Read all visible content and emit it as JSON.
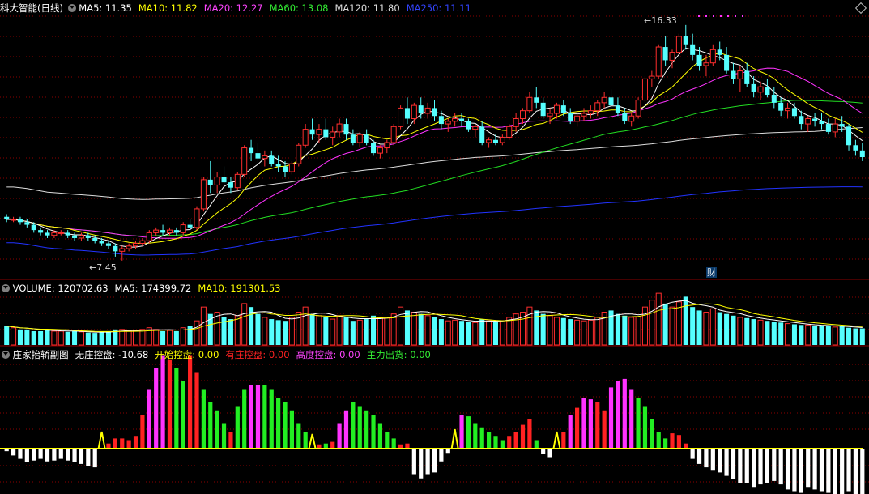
{
  "main_panel": {
    "title": "科大智能(日线)",
    "ma_labels": [
      {
        "text": "MA5: 11.35",
        "color": "#ffffff"
      },
      {
        "text": "MA10: 11.82",
        "color": "#ffff00"
      },
      {
        "text": "MA20: 12.27",
        "color": "#ff44ff"
      },
      {
        "text": "MA60: 13.08",
        "color": "#33ee33"
      },
      {
        "text": "MA120: 11.80",
        "color": "#dddddd"
      },
      {
        "text": "MA250: 11.11",
        "color": "#3344ff"
      }
    ],
    "high_label": "16.33",
    "low_label": "7.45",
    "event_marker": "财",
    "settings_icon": "diamond-icon"
  },
  "volume_panel": {
    "labels": [
      {
        "text": "VOLUME: 120702.63",
        "color": "#ffffff"
      },
      {
        "text": "MA5: 174399.72",
        "color": "#ffffff"
      },
      {
        "text": "MA10: 191301.53",
        "color": "#ffff00"
      }
    ]
  },
  "indicator_panel": {
    "labels": [
      {
        "text": "庄家抬轿副图",
        "color": "#ffffff"
      },
      {
        "text": "无庄控盘: -10.68",
        "color": "#ffffff"
      },
      {
        "text": "开始控盘: 0.00",
        "color": "#ffff00"
      },
      {
        "text": "有庄控盘: 0.00",
        "color": "#ff2222"
      },
      {
        "text": "高度控盘: 0.00",
        "color": "#ff44ff"
      },
      {
        "text": "主力出货: 0.00",
        "color": "#33ee33"
      }
    ]
  },
  "colors": {
    "up": "#ff2e2e",
    "down": "#55ffff",
    "grid": "#8b0000",
    "magenta": "#ff33ff",
    "green": "#22ee22",
    "red": "#ff2222",
    "yellow": "#ffff00",
    "white": "#ffffff"
  },
  "chart_data": {
    "type": "candlestick",
    "price_high": 16.33,
    "price_low": 7.45,
    "candles": [
      [
        9.1,
        9.2,
        8.9,
        9.0
      ],
      [
        9.0,
        9.1,
        8.9,
        9.0
      ],
      [
        9.0,
        9.1,
        8.8,
        8.9
      ],
      [
        8.9,
        9.0,
        8.7,
        8.8
      ],
      [
        8.8,
        8.9,
        8.5,
        8.6
      ],
      [
        8.6,
        8.7,
        8.4,
        8.5
      ],
      [
        8.5,
        8.6,
        8.3,
        8.4
      ],
      [
        8.4,
        8.6,
        8.3,
        8.5
      ],
      [
        8.5,
        8.6,
        8.4,
        8.5
      ],
      [
        8.5,
        8.6,
        8.3,
        8.4
      ],
      [
        8.4,
        8.5,
        8.2,
        8.3
      ],
      [
        8.3,
        8.5,
        8.2,
        8.4
      ],
      [
        8.4,
        8.5,
        8.2,
        8.3
      ],
      [
        8.3,
        8.4,
        8.1,
        8.2
      ],
      [
        8.2,
        8.3,
        8.0,
        8.1
      ],
      [
        8.1,
        8.2,
        7.9,
        8.0
      ],
      [
        8.0,
        8.1,
        7.6,
        7.8
      ],
      [
        7.8,
        8.0,
        7.45,
        7.9
      ],
      [
        7.9,
        8.1,
        7.8,
        8.0
      ],
      [
        8.0,
        8.2,
        7.9,
        8.1
      ],
      [
        8.1,
        8.3,
        8.0,
        8.2
      ],
      [
        8.2,
        8.6,
        8.1,
        8.5
      ],
      [
        8.5,
        8.7,
        8.4,
        8.6
      ],
      [
        8.6,
        8.8,
        8.4,
        8.5
      ],
      [
        8.5,
        8.7,
        8.4,
        8.6
      ],
      [
        8.6,
        8.7,
        8.4,
        8.5
      ],
      [
        8.5,
        8.9,
        8.4,
        8.8
      ],
      [
        8.8,
        9.0,
        8.6,
        8.7
      ],
      [
        8.7,
        9.5,
        8.6,
        9.4
      ],
      [
        9.4,
        10.6,
        9.3,
        10.5
      ],
      [
        10.5,
        11.2,
        10.0,
        10.3
      ],
      [
        10.3,
        10.8,
        10.0,
        10.6
      ],
      [
        10.6,
        11.0,
        10.2,
        10.4
      ],
      [
        10.4,
        10.6,
        10.0,
        10.2
      ],
      [
        10.2,
        10.8,
        10.1,
        10.7
      ],
      [
        10.7,
        11.8,
        10.6,
        11.7
      ],
      [
        11.7,
        12.0,
        11.2,
        11.5
      ],
      [
        11.5,
        11.9,
        11.1,
        11.3
      ],
      [
        11.3,
        11.6,
        11.0,
        11.4
      ],
      [
        11.4,
        11.6,
        11.0,
        11.1
      ],
      [
        11.1,
        11.4,
        10.8,
        11.0
      ],
      [
        11.0,
        11.2,
        10.6,
        10.8
      ],
      [
        10.8,
        11.2,
        10.7,
        11.1
      ],
      [
        11.1,
        11.9,
        11.0,
        11.8
      ],
      [
        11.8,
        12.6,
        11.7,
        12.4
      ],
      [
        12.4,
        12.8,
        12.0,
        12.2
      ],
      [
        12.2,
        12.6,
        11.9,
        12.4
      ],
      [
        12.4,
        12.8,
        12.0,
        12.1
      ],
      [
        12.1,
        12.5,
        11.8,
        12.3
      ],
      [
        12.3,
        12.8,
        12.1,
        12.6
      ],
      [
        12.6,
        12.8,
        12.0,
        12.2
      ],
      [
        12.2,
        12.4,
        11.8,
        11.9
      ],
      [
        11.9,
        12.3,
        11.7,
        12.2
      ],
      [
        12.2,
        12.4,
        11.8,
        11.9
      ],
      [
        11.9,
        12.0,
        11.4,
        11.5
      ],
      [
        11.5,
        11.8,
        11.3,
        11.7
      ],
      [
        11.7,
        12.0,
        11.5,
        11.9
      ],
      [
        11.9,
        12.6,
        11.8,
        12.5
      ],
      [
        12.5,
        13.3,
        12.4,
        13.2
      ],
      [
        13.2,
        13.6,
        12.6,
        12.8
      ],
      [
        12.8,
        13.4,
        12.6,
        13.3
      ],
      [
        13.3,
        13.6,
        12.8,
        13.0
      ],
      [
        13.0,
        13.4,
        12.8,
        13.2
      ],
      [
        13.2,
        13.5,
        12.7,
        12.9
      ],
      [
        12.9,
        13.1,
        12.4,
        12.6
      ],
      [
        12.6,
        12.8,
        12.3,
        12.7
      ],
      [
        12.7,
        13.0,
        12.5,
        12.8
      ],
      [
        12.8,
        13.0,
        12.5,
        12.7
      ],
      [
        12.7,
        12.8,
        12.3,
        12.4
      ],
      [
        12.4,
        12.6,
        12.1,
        12.5
      ],
      [
        12.5,
        12.7,
        11.8,
        11.9
      ],
      [
        11.9,
        12.1,
        11.7,
        12.0
      ],
      [
        12.0,
        12.2,
        11.8,
        11.9
      ],
      [
        11.9,
        12.2,
        11.8,
        12.1
      ],
      [
        12.1,
        12.6,
        12.0,
        12.5
      ],
      [
        12.5,
        13.0,
        12.3,
        12.8
      ],
      [
        12.8,
        13.2,
        12.6,
        13.1
      ],
      [
        13.1,
        13.8,
        13.0,
        13.6
      ],
      [
        13.6,
        14.0,
        13.2,
        13.4
      ],
      [
        13.4,
        13.6,
        12.8,
        12.9
      ],
      [
        12.9,
        13.2,
        12.6,
        13.0
      ],
      [
        13.0,
        13.4,
        12.8,
        13.3
      ],
      [
        13.3,
        13.5,
        12.9,
        13.0
      ],
      [
        13.0,
        13.2,
        12.6,
        12.7
      ],
      [
        12.7,
        13.0,
        12.5,
        12.9
      ],
      [
        12.9,
        13.2,
        12.7,
        13.0
      ],
      [
        13.0,
        13.3,
        12.8,
        13.1
      ],
      [
        13.1,
        13.5,
        12.9,
        13.4
      ],
      [
        13.4,
        13.8,
        13.2,
        13.6
      ],
      [
        13.6,
        13.9,
        13.2,
        13.3
      ],
      [
        13.3,
        13.6,
        12.9,
        13.0
      ],
      [
        13.0,
        13.2,
        12.6,
        12.7
      ],
      [
        12.7,
        13.0,
        12.5,
        12.9
      ],
      [
        12.9,
        13.6,
        12.8,
        13.5
      ],
      [
        13.5,
        14.4,
        13.4,
        14.3
      ],
      [
        14.3,
        14.6,
        14.0,
        14.4
      ],
      [
        14.4,
        15.6,
        14.3,
        15.5
      ],
      [
        15.5,
        15.9,
        14.8,
        15.0
      ],
      [
        15.0,
        15.4,
        14.7,
        15.3
      ],
      [
        15.3,
        16.0,
        15.2,
        15.9
      ],
      [
        15.9,
        16.33,
        15.4,
        15.6
      ],
      [
        15.6,
        16.0,
        15.0,
        15.2
      ],
      [
        15.2,
        15.5,
        14.6,
        14.8
      ],
      [
        14.8,
        15.2,
        14.4,
        14.9
      ],
      [
        14.9,
        15.6,
        14.8,
        15.4
      ],
      [
        15.4,
        15.7,
        15.0,
        15.2
      ],
      [
        15.2,
        15.5,
        14.5,
        14.6
      ],
      [
        14.6,
        14.9,
        14.1,
        14.3
      ],
      [
        14.3,
        14.8,
        13.8,
        14.6
      ],
      [
        14.6,
        14.9,
        14.0,
        14.1
      ],
      [
        14.1,
        14.4,
        13.6,
        13.8
      ],
      [
        13.8,
        14.2,
        13.5,
        14.0
      ],
      [
        14.0,
        14.3,
        13.6,
        13.7
      ],
      [
        13.7,
        14.0,
        13.2,
        13.4
      ],
      [
        13.4,
        13.6,
        12.9,
        13.1
      ],
      [
        13.1,
        13.4,
        12.8,
        13.2
      ],
      [
        13.2,
        13.4,
        12.8,
        12.9
      ],
      [
        12.9,
        13.1,
        12.4,
        12.6
      ],
      [
        12.6,
        12.9,
        12.3,
        12.8
      ],
      [
        12.8,
        13.0,
        12.5,
        12.7
      ],
      [
        12.7,
        13.0,
        12.4,
        12.6
      ],
      [
        12.6,
        12.8,
        12.2,
        12.3
      ],
      [
        12.3,
        12.8,
        12.1,
        12.6
      ],
      [
        12.6,
        12.9,
        12.3,
        12.5
      ],
      [
        12.5,
        12.6,
        11.6,
        11.8
      ],
      [
        11.8,
        12.0,
        11.4,
        11.6
      ],
      [
        11.6,
        11.9,
        11.2,
        11.35
      ]
    ],
    "volume": [
      55,
      50,
      45,
      45,
      40,
      40,
      45,
      40,
      40,
      38,
      40,
      38,
      36,
      35,
      38,
      40,
      45,
      45,
      40,
      40,
      45,
      50,
      45,
      40,
      42,
      40,
      50,
      55,
      70,
      110,
      90,
      95,
      80,
      75,
      85,
      120,
      110,
      90,
      80,
      75,
      72,
      70,
      80,
      95,
      110,
      90,
      85,
      80,
      75,
      85,
      80,
      70,
      72,
      75,
      85,
      80,
      78,
      90,
      110,
      100,
      95,
      90,
      85,
      80,
      75,
      70,
      72,
      70,
      68,
      65,
      75,
      70,
      68,
      70,
      80,
      90,
      95,
      110,
      100,
      90,
      85,
      80,
      78,
      75,
      72,
      70,
      72,
      80,
      95,
      100,
      90,
      85,
      80,
      82,
      110,
      130,
      150,
      120,
      110,
      125,
      140,
      110,
      100,
      95,
      105,
      95,
      90,
      85,
      80,
      78,
      75,
      72,
      70,
      68,
      65,
      62,
      60,
      58,
      58,
      56,
      55,
      55,
      52,
      55,
      50,
      48,
      48
    ],
    "indicator": [
      [
        "w",
        -3
      ],
      [
        "w",
        -8
      ],
      [
        "w",
        -12
      ],
      [
        "w",
        -16
      ],
      [
        "w",
        -14
      ],
      [
        "w",
        -12
      ],
      [
        "w",
        -15
      ],
      [
        "w",
        -14
      ],
      [
        "w",
        -12
      ],
      [
        "w",
        -14
      ],
      [
        "w",
        -16
      ],
      [
        "w",
        -18
      ],
      [
        "w",
        -20
      ],
      [
        "w",
        -22
      ],
      [
        "y",
        14
      ],
      [
        "r",
        6
      ],
      [
        "r",
        12
      ],
      [
        "r",
        12
      ],
      [
        "r",
        10
      ],
      [
        "r",
        15
      ],
      [
        "r",
        40
      ],
      [
        "m",
        70
      ],
      [
        "m",
        95
      ],
      [
        "m",
        110
      ],
      [
        "r",
        105
      ],
      [
        "g",
        95
      ],
      [
        "g",
        80
      ],
      [
        "r",
        110
      ],
      [
        "r",
        90
      ],
      [
        "g",
        70
      ],
      [
        "g",
        55
      ],
      [
        "g",
        45
      ],
      [
        "g",
        30
      ],
      [
        "r",
        20
      ],
      [
        "g",
        50
      ],
      [
        "g",
        70
      ],
      [
        "m",
        75
      ],
      [
        "m",
        75
      ],
      [
        "g",
        75
      ],
      [
        "g",
        70
      ],
      [
        "g",
        60
      ],
      [
        "g",
        55
      ],
      [
        "g",
        45
      ],
      [
        "g",
        30
      ],
      [
        "g",
        20
      ],
      [
        "y",
        12
      ],
      [
        "r",
        5
      ],
      [
        "g",
        6
      ],
      [
        "r",
        8
      ],
      [
        "m",
        30
      ],
      [
        "m",
        45
      ],
      [
        "g",
        55
      ],
      [
        "g",
        50
      ],
      [
        "g",
        45
      ],
      [
        "g",
        40
      ],
      [
        "g",
        30
      ],
      [
        "g",
        20
      ],
      [
        "g",
        12
      ],
      [
        "r",
        5
      ],
      [
        "r",
        6
      ],
      [
        "w",
        -30
      ],
      [
        "w",
        -35
      ],
      [
        "w",
        -30
      ],
      [
        "w",
        -28
      ],
      [
        "w",
        -15
      ],
      [
        "w",
        -5
      ],
      [
        "y",
        16
      ],
      [
        "m",
        40
      ],
      [
        "g",
        38
      ],
      [
        "g",
        30
      ],
      [
        "g",
        25
      ],
      [
        "g",
        20
      ],
      [
        "g",
        15
      ],
      [
        "g",
        10
      ],
      [
        "r",
        15
      ],
      [
        "r",
        20
      ],
      [
        "r",
        28
      ],
      [
        "r",
        35
      ],
      [
        "g",
        10
      ],
      [
        "w",
        -6
      ],
      [
        "w",
        -10
      ],
      [
        "y",
        14
      ],
      [
        "r",
        20
      ],
      [
        "m",
        40
      ],
      [
        "r",
        48
      ],
      [
        "m",
        60
      ],
      [
        "m",
        58
      ],
      [
        "r",
        55
      ],
      [
        "r",
        45
      ],
      [
        "m",
        72
      ],
      [
        "m",
        80
      ],
      [
        "m",
        82
      ],
      [
        "m",
        70
      ],
      [
        "g",
        60
      ],
      [
        "g",
        50
      ],
      [
        "g",
        35
      ],
      [
        "g",
        20
      ],
      [
        "g",
        12
      ],
      [
        "r",
        18
      ],
      [
        "r",
        16
      ],
      [
        "r",
        6
      ],
      [
        "w",
        -12
      ],
      [
        "w",
        -18
      ],
      [
        "w",
        -22
      ],
      [
        "w",
        -25
      ],
      [
        "w",
        -28
      ],
      [
        "w",
        -32
      ],
      [
        "w",
        -36
      ],
      [
        "w",
        -40
      ],
      [
        "w",
        -40
      ],
      [
        "w",
        -45
      ],
      [
        "w",
        -42
      ],
      [
        "w",
        -40
      ],
      [
        "w",
        -38
      ],
      [
        "w",
        -42
      ],
      [
        "w",
        -48
      ],
      [
        "w",
        -50
      ],
      [
        "w",
        -52
      ],
      [
        "w",
        -45
      ],
      [
        "w",
        -48
      ],
      [
        "w",
        -50
      ],
      [
        "w",
        -52
      ],
      [
        "w",
        -54
      ],
      [
        "w",
        -55
      ],
      [
        "w",
        -50
      ],
      [
        "w",
        -54
      ],
      [
        "w",
        -56
      ]
    ]
  }
}
